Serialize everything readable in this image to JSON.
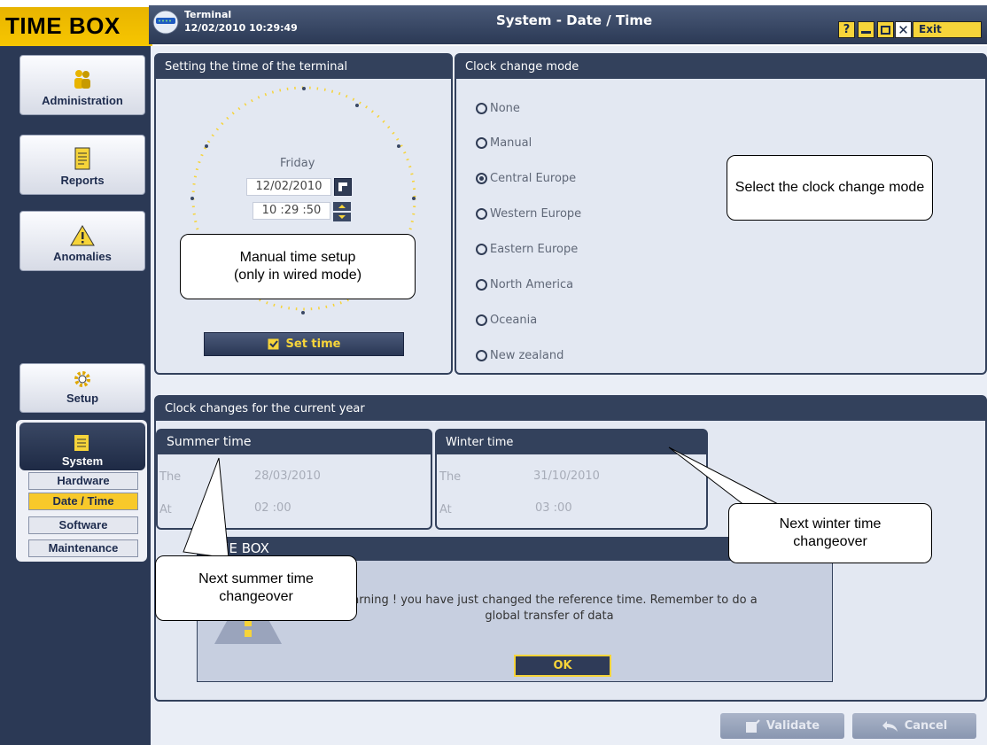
{
  "app": {
    "logo": "TIME BOX",
    "terminal_label": "Terminal",
    "terminal_datetime": "12/02/2010 10:29:49",
    "page_title": "System - Date / Time",
    "help_label": "?",
    "exit_label": "Exit"
  },
  "sidebar": {
    "administration": "Administration",
    "reports": "Reports",
    "anomalies": "Anomalies",
    "setup": "Setup",
    "system": "System",
    "sub_items": [
      "Hardware",
      "Date / Time",
      "Software",
      "Maintenance"
    ],
    "active_sub_item": "Date / Time"
  },
  "time_panel": {
    "title": "Setting the time of the terminal",
    "day": "Friday",
    "date": "12/02/2010",
    "time": "10 :29 :50",
    "set_time_label": "Set time"
  },
  "clock_mode": {
    "title": "Clock change mode",
    "options": [
      "None",
      "Manual",
      "Central Europe",
      "Western Europe",
      "Eastern Europe",
      "North America",
      "Oceania",
      "New zealand"
    ],
    "selected": "Central Europe"
  },
  "clock_changes": {
    "title": "Clock changes for the current year",
    "summer": {
      "title": "Summer time",
      "the_label": "The",
      "date": "28/03/2010",
      "at_label": "At",
      "time": "02 :00"
    },
    "winter": {
      "title": "Winter time",
      "the_label": "The",
      "date": "31/10/2010",
      "at_label": "At",
      "time": "03 :00"
    }
  },
  "dialog": {
    "title": "TIME BOX",
    "message_line1": "Warning ! you have just changed the reference time. Remember to do a",
    "message_line2": "global transfer of data",
    "ok_label": "OK"
  },
  "footer": {
    "validate_label": "Validate",
    "cancel_label": "Cancel"
  },
  "callouts": {
    "select_mode": "Select the clock change mode",
    "manual_setup_line1": "Manual time setup",
    "manual_setup_line2": "(only in wired mode)",
    "next_winter_line1": "Next winter time",
    "next_winter_line2": "changeover",
    "next_summer_line1": "Next summer time",
    "next_summer_line2": "changeover"
  },
  "colors": {
    "accent_yellow": "#f8c92a",
    "navy": "#2b3955",
    "panel_bg": "#e3e8f2"
  }
}
